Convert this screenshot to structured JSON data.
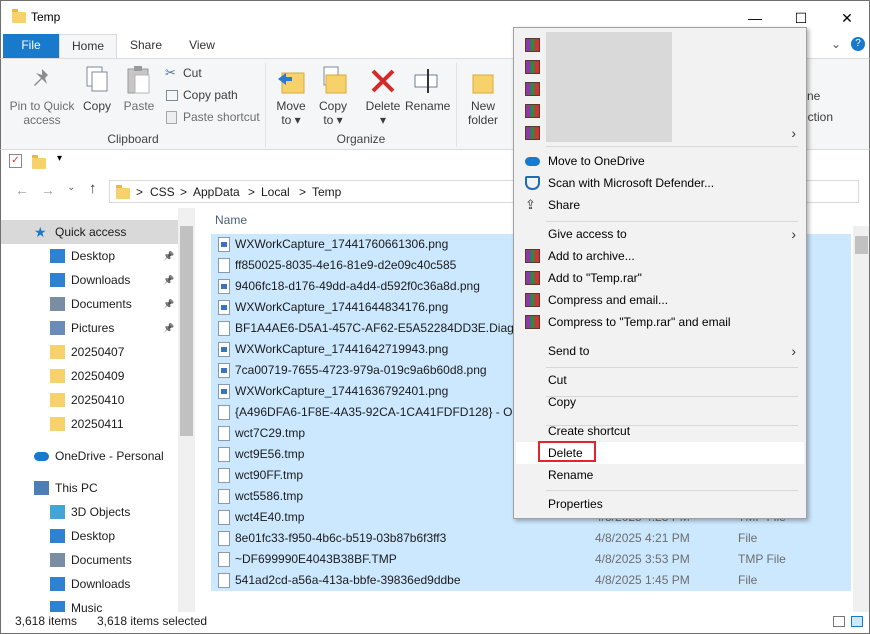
{
  "window": {
    "title": "Temp",
    "minimize": "—",
    "maximize": "☐",
    "close": "✕"
  },
  "ribbon_tabs": [
    "File",
    "Home",
    "Share",
    "View"
  ],
  "ribbon": {
    "clipboard": {
      "pin": [
        "Pin to Quick",
        "access"
      ],
      "copy": "Copy",
      "paste": "Paste",
      "cut": "Cut",
      "copy_path": "Copy path",
      "paste_shortcut": "Paste shortcut",
      "group": "Clipboard"
    },
    "organize": {
      "move_to": [
        "Move",
        "to ▾"
      ],
      "copy_to": [
        "Copy",
        "to ▾"
      ],
      "delete": [
        "Delete",
        "▾"
      ],
      "rename": "Rename",
      "group": "Organize"
    },
    "new": {
      "new_folder": [
        "New",
        "folder"
      ]
    },
    "partial_right": [
      "ne",
      "ection"
    ]
  },
  "address": {
    "crumbs": [
      "CSS",
      "AppData",
      "Local",
      "Temp"
    ],
    "sep": ">"
  },
  "nav": {
    "items": [
      {
        "label": "Quick access",
        "icon": "star-icon",
        "pin": false,
        "active": true
      },
      {
        "label": "Desktop",
        "icon": "desktop-icon",
        "pin": true
      },
      {
        "label": "Downloads",
        "icon": "download-icon",
        "pin": true
      },
      {
        "label": "Documents",
        "icon": "documents-icon",
        "pin": true
      },
      {
        "label": "Pictures",
        "icon": "pictures-icon",
        "pin": true
      },
      {
        "label": "20250407",
        "icon": "folder-icon",
        "pin": false
      },
      {
        "label": "20250409",
        "icon": "folder-icon",
        "pin": false
      },
      {
        "label": "20250410",
        "icon": "folder-icon",
        "pin": false
      },
      {
        "label": "20250411",
        "icon": "folder-icon",
        "pin": false
      },
      {
        "label": "OneDrive - Personal",
        "icon": "cloud-icon",
        "pin": false
      },
      {
        "label": "This PC",
        "icon": "pc-icon",
        "pin": false
      },
      {
        "label": "3D Objects",
        "icon": "cube-icon",
        "pin": false
      },
      {
        "label": "Desktop",
        "icon": "desktop-icon",
        "pin": false
      },
      {
        "label": "Documents",
        "icon": "documents-icon",
        "pin": false
      },
      {
        "label": "Downloads",
        "icon": "download-icon",
        "pin": false
      },
      {
        "label": "Music",
        "icon": "music-icon",
        "pin": false
      }
    ]
  },
  "filelist": {
    "header_name": "Name",
    "rows": [
      {
        "name": "WXWorkCapture_17441760661306.png",
        "png": true,
        "date": "",
        "type": "",
        "sel": true
      },
      {
        "name": "ff850025-8035-4e16-81e9-d2e09c40c585",
        "png": false,
        "date": "",
        "type": "",
        "sel": true
      },
      {
        "name": "9406fc18-d176-49dd-a4d4-d592f0c36a8d.png",
        "png": true,
        "date": "",
        "type": "",
        "sel": true
      },
      {
        "name": "WXWorkCapture_17441644834176.png",
        "png": true,
        "date": "",
        "type": "",
        "sel": true
      },
      {
        "name": "BF1A4AE6-D5A1-457C-AF62-E5A52284DD3E.Diagnos",
        "png": false,
        "date": "",
        "type": "",
        "sel": true
      },
      {
        "name": "WXWorkCapture_17441642719943.png",
        "png": true,
        "date": "",
        "type": "",
        "sel": true
      },
      {
        "name": "7ca00719-7655-4723-979a-019c9a6b60d8.png",
        "png": true,
        "date": "",
        "type": "",
        "sel": true
      },
      {
        "name": "WXWorkCapture_17441636792401.png",
        "png": true,
        "date": "",
        "type": "",
        "sel": true
      },
      {
        "name": "{A496DFA6-1F8E-4A35-92CA-1CA41FDFD128} - OProc",
        "png": false,
        "date": "",
        "type": "",
        "sel": true
      },
      {
        "name": "wct7C29.tmp",
        "png": false,
        "date": "",
        "type": "",
        "sel": true
      },
      {
        "name": "wct9E56.tmp",
        "png": false,
        "date": "",
        "type": "",
        "sel": true
      },
      {
        "name": "wct90FF.tmp",
        "png": false,
        "date": "",
        "type": "",
        "sel": true
      },
      {
        "name": "wct5586.tmp",
        "png": false,
        "date": "",
        "type": "",
        "sel": true
      },
      {
        "name": "wct4E40.tmp",
        "png": false,
        "date": "4/8/2025 4:23 PM",
        "type": "TMP File",
        "sel": true
      },
      {
        "name": "8e01fc33-f950-4b6c-b519-03b87b6f3ff3",
        "png": false,
        "date": "4/8/2025 4:21 PM",
        "type": "File",
        "sel": true
      },
      {
        "name": "~DF699990E4043B38BF.TMP",
        "png": false,
        "date": "4/8/2025 3:53 PM",
        "type": "TMP File",
        "sel": true
      },
      {
        "name": "541ad2cd-a56a-413a-bbfe-39836ed9ddbe",
        "png": false,
        "date": "4/8/2025 1:45 PM",
        "type": "File",
        "sel": true
      }
    ]
  },
  "status": {
    "count": "3,618 items",
    "selected": "3,618 items selected"
  },
  "context_menu": {
    "top_items": 5,
    "items": [
      {
        "label": "Move to OneDrive",
        "icon": "cloud-icon",
        "sub": false
      },
      {
        "label": "Scan with Microsoft Defender...",
        "icon": "shield-icon",
        "sub": false
      },
      {
        "label": "Share",
        "icon": "share-icon",
        "sub": false
      },
      {
        "label": "Give access to",
        "icon": "",
        "sub": true
      },
      {
        "label": "Add to archive...",
        "icon": "winrar-icon",
        "sub": false
      },
      {
        "label": "Add to \"Temp.rar\"",
        "icon": "winrar-icon",
        "sub": false
      },
      {
        "label": "Compress and email...",
        "icon": "winrar-icon",
        "sub": false
      },
      {
        "label": "Compress to \"Temp.rar\" and email",
        "icon": "winrar-icon",
        "sub": false
      },
      {
        "label": "Send to",
        "icon": "",
        "sub": true
      },
      {
        "label": "Cut",
        "icon": "",
        "sub": false
      },
      {
        "label": "Copy",
        "icon": "",
        "sub": false
      },
      {
        "label": "Create shortcut",
        "icon": "",
        "sub": false
      },
      {
        "label": "Delete",
        "icon": "",
        "sub": false
      },
      {
        "label": "Rename",
        "icon": "",
        "sub": false
      },
      {
        "label": "Properties",
        "icon": "",
        "sub": false
      }
    ]
  },
  "colors": {
    "accent": "#1979ca",
    "selection": "#cce8ff",
    "highlight_box": "#e0262b"
  }
}
